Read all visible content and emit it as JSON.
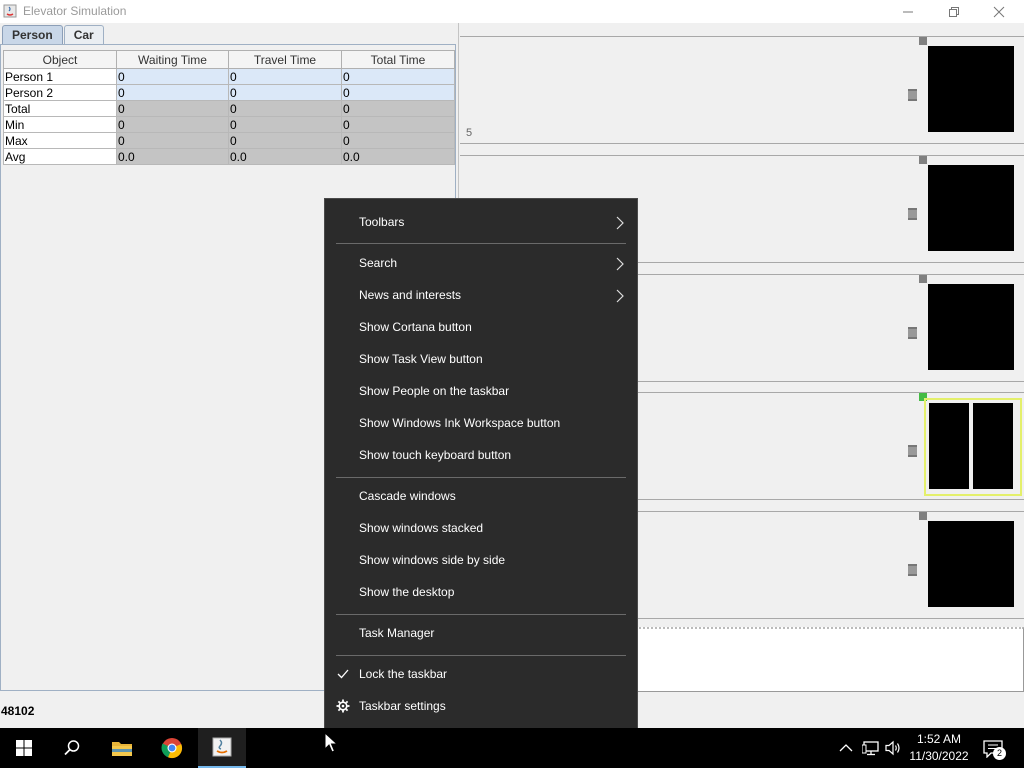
{
  "window": {
    "title": "Elevator Simulation",
    "minimize_label": "—",
    "restore_label": "❐",
    "close_label": "✕"
  },
  "tabs": [
    {
      "label": "Person",
      "active": true
    },
    {
      "label": "Car",
      "active": false
    }
  ],
  "table": {
    "headers": [
      "Object",
      "Waiting Time",
      "Travel Time",
      "Total Time"
    ],
    "rows": [
      {
        "kind": "person",
        "cells": [
          "Person 1",
          "0",
          "0",
          "0"
        ]
      },
      {
        "kind": "person",
        "cells": [
          "Person 2",
          "0",
          "0",
          "0"
        ]
      },
      {
        "kind": "stat",
        "cells": [
          "Total",
          "0",
          "0",
          "0"
        ]
      },
      {
        "kind": "stat",
        "cells": [
          "Min",
          "0",
          "0",
          "0"
        ]
      },
      {
        "kind": "stat",
        "cells": [
          "Max",
          "0",
          "0",
          "0"
        ]
      },
      {
        "kind": "stat",
        "cells": [
          "Avg",
          "0.0",
          "0.0",
          "0.0"
        ]
      }
    ]
  },
  "status": {
    "value": "48102"
  },
  "floors": [
    {
      "label": "5",
      "car_state": "closed"
    },
    {
      "label": "",
      "car_state": "closed"
    },
    {
      "label": "",
      "car_state": "closed"
    },
    {
      "label": "",
      "car_state": "open"
    },
    {
      "label": "",
      "car_state": "closed"
    }
  ],
  "context_menu": {
    "items": [
      {
        "label": "Toolbars",
        "submenu": true
      },
      {
        "label": "Search",
        "submenu": true
      },
      {
        "label": "News and interests",
        "submenu": true
      },
      {
        "label": "Show Cortana button"
      },
      {
        "label": "Show Task View button"
      },
      {
        "label": "Show People on the taskbar"
      },
      {
        "label": "Show Windows Ink Workspace button"
      },
      {
        "label": "Show touch keyboard button"
      },
      {
        "label": "Cascade windows"
      },
      {
        "label": "Show windows stacked"
      },
      {
        "label": "Show windows side by side"
      },
      {
        "label": "Show the desktop"
      },
      {
        "label": "Task Manager"
      },
      {
        "label": "Lock the taskbar",
        "checked": true
      },
      {
        "label": "Taskbar settings",
        "icon": "gear-icon"
      }
    ]
  },
  "taskbar": {
    "time": "1:52 AM",
    "date": "11/30/2022",
    "notification_count": "2",
    "accent": "#76b9ed"
  }
}
